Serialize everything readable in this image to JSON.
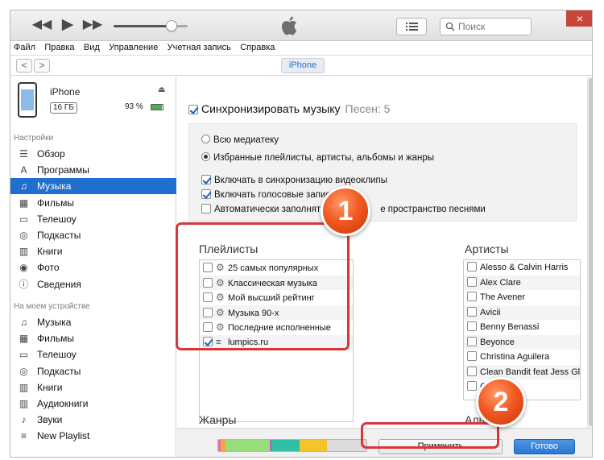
{
  "toolbar": {
    "volume_level": 0.78,
    "search_placeholder": "Поиск",
    "close_label": "×"
  },
  "menu": [
    "Файл",
    "Правка",
    "Вид",
    "Управление",
    "Учетная запись",
    "Справка"
  ],
  "nav": {
    "back": "<",
    "forward": ">",
    "device_tab": "iPhone"
  },
  "device": {
    "name": "iPhone",
    "capacity": "16 ГБ",
    "battery_text": "93 %",
    "battery_level": 0.93
  },
  "sidebar": {
    "settings_title": "Настройки",
    "settings_items": [
      {
        "label": "Обзор",
        "icon": "summary-icon"
      },
      {
        "label": "Программы",
        "icon": "apps-icon"
      },
      {
        "label": "Музыка",
        "icon": "music-icon",
        "active": true
      },
      {
        "label": "Фильмы",
        "icon": "film-icon"
      },
      {
        "label": "Телешоу",
        "icon": "tv-icon"
      },
      {
        "label": "Подкасты",
        "icon": "podcast-icon"
      },
      {
        "label": "Книги",
        "icon": "book-icon"
      },
      {
        "label": "Фото",
        "icon": "camera-icon"
      },
      {
        "label": "Сведения",
        "icon": "info-icon"
      }
    ],
    "device_title": "На моем устройстве",
    "device_items": [
      {
        "label": "Музыка",
        "icon": "music-icon"
      },
      {
        "label": "Фильмы",
        "icon": "film-icon"
      },
      {
        "label": "Телешоу",
        "icon": "tv-icon"
      },
      {
        "label": "Подкасты",
        "icon": "podcast-icon"
      },
      {
        "label": "Книги",
        "icon": "book-icon"
      },
      {
        "label": "Аудиокниги",
        "icon": "audiobook-icon"
      },
      {
        "label": "Звуки",
        "icon": "bell-icon"
      },
      {
        "label": "New Playlist",
        "icon": "playlist-icon"
      }
    ]
  },
  "main": {
    "sync_label": "Синхронизировать музыку",
    "sync_count": "Песен: 5",
    "sync_checked": true,
    "radio_all": "Всю медиатеку",
    "radio_selected": "Избранные плейлисты, артисты, альбомы и жанры",
    "opt_videos": "Включать в синхронизацию видеоклипы",
    "opt_voice": "Включать голосовые записи",
    "opt_autofill_start": "Автоматически заполнят",
    "opt_autofill_end": "е пространство песнями",
    "playlists_title": "Плейлисты",
    "playlists": [
      {
        "label": "25 самых популярных",
        "checked": false,
        "icon": "gear-icon"
      },
      {
        "label": "Классическая музыка",
        "checked": false,
        "icon": "gear-icon"
      },
      {
        "label": "Мой высший рейтинг",
        "checked": false,
        "icon": "gear-icon"
      },
      {
        "label": "Музыка 90-х",
        "checked": false,
        "icon": "gear-icon"
      },
      {
        "label": "Последние исполненные",
        "checked": false,
        "icon": "gear-icon"
      },
      {
        "label": "lumpics.ru",
        "checked": true,
        "icon": "playlist-icon"
      }
    ],
    "artists_title": "Артисты",
    "artists": [
      "Alesso & Calvin Harris",
      "Alex Clare",
      "The Avener",
      "Avicii",
      "Benny Benassi",
      "Beyonce",
      "Christina Aguilera",
      "Clean Bandit feat Jess Glynne",
      "Corona"
    ],
    "genres_title": "Жанры",
    "albums_title": "Альбо"
  },
  "footer": {
    "apply_label": "Применить",
    "done_label": "Готово"
  },
  "badges": {
    "one": "1",
    "two": "2"
  },
  "colors": {
    "accent": "#1f6fcf",
    "highlight": "#d9363b",
    "badge": "#f25a22"
  }
}
